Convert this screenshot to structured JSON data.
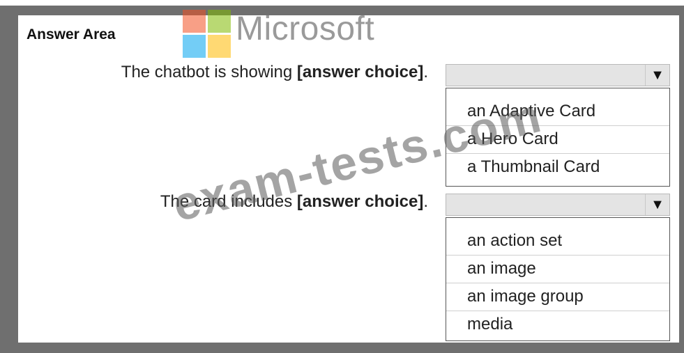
{
  "header": {
    "title": "Answer Area",
    "logo_text": "Microsoft"
  },
  "questions": [
    {
      "prefix": "The chatbot is showing ",
      "placeholder": "[answer choice]",
      "suffix": ".",
      "options": [
        "an Adaptive Card",
        "a Hero Card",
        "a Thumbnail Card"
      ]
    },
    {
      "prefix": "The card includes ",
      "placeholder": "[answer choice]",
      "suffix": ".",
      "options": [
        "an action set",
        "an image",
        "an image group",
        "media"
      ]
    }
  ],
  "dropdown_arrow": "▼",
  "watermark": "exam-tests.com"
}
